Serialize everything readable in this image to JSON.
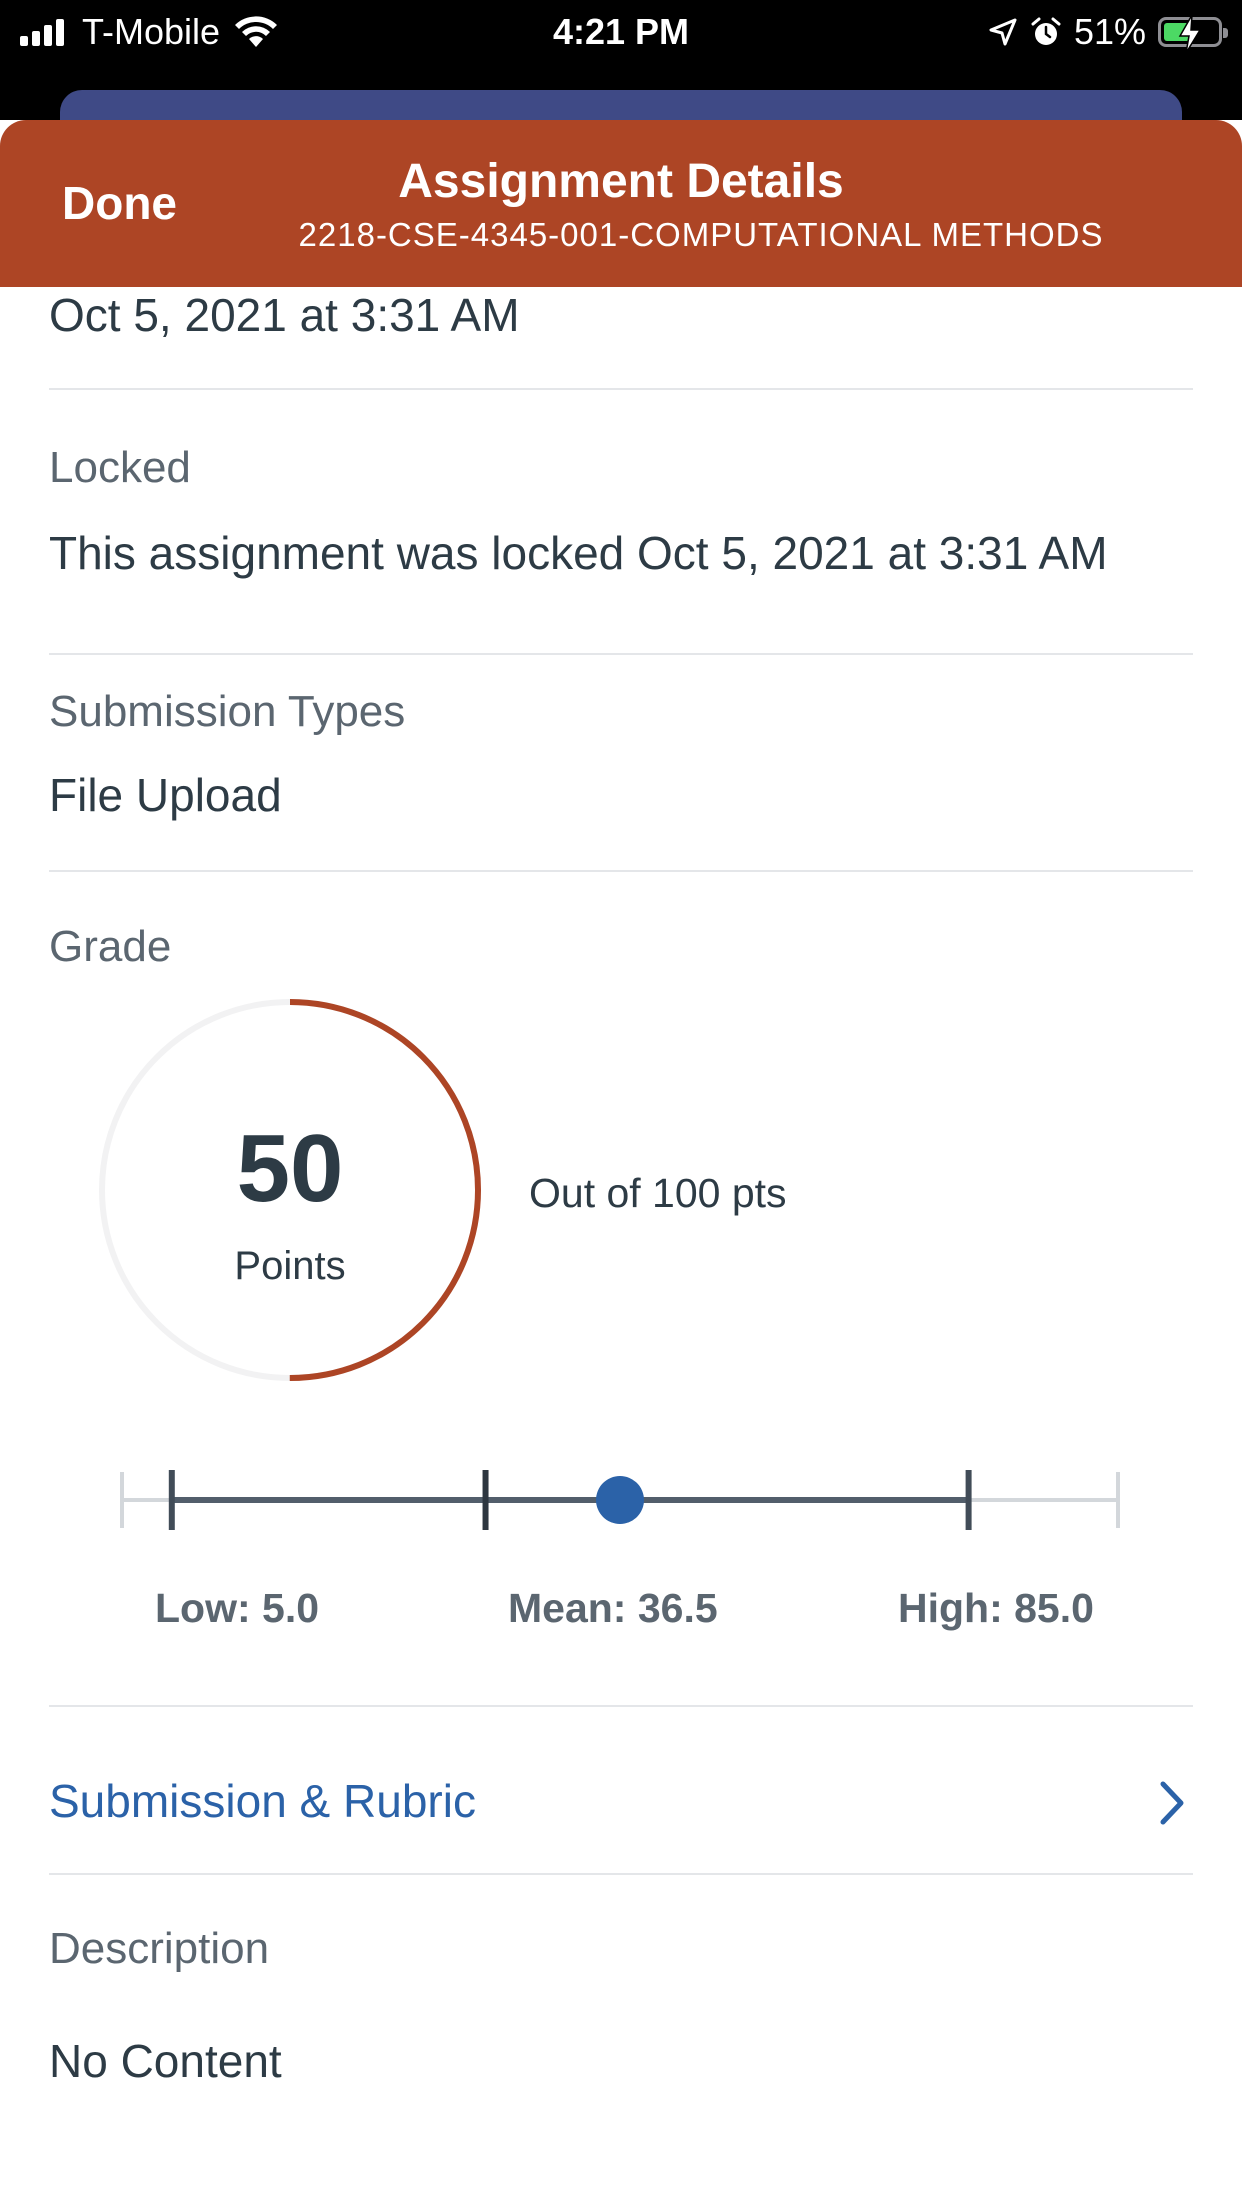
{
  "status_bar": {
    "carrier": "T-Mobile",
    "time": "4:21 PM",
    "battery": "51%",
    "icons": [
      "signal-icon",
      "wifi-icon",
      "location-icon",
      "alarm-icon",
      "battery-charging-icon"
    ]
  },
  "header": {
    "done_label": "Done",
    "title": "Assignment Details",
    "subtitle": "2218-CSE-4345-001-COMPUTATIONAL METHODS",
    "color": "#ad4525"
  },
  "due": {
    "value": "Oct 5, 2021 at 3:31 AM"
  },
  "locked": {
    "label": "Locked",
    "value": "This assignment was locked Oct 5, 2021 at 3:31 AM"
  },
  "submission_types": {
    "label": "Submission Types",
    "value": "File Upload"
  },
  "grade": {
    "label": "Grade",
    "score": "50",
    "score_unit": "Points",
    "out_of": "Out of 100 pts",
    "fraction": 0.5,
    "ring_color": "#ad4525"
  },
  "distribution": {
    "low_label": "Low: 5.0",
    "mean_label": "Mean: 36.5",
    "high_label": "High: 85.0",
    "low": 5.0,
    "mean": 36.5,
    "high": 85.0,
    "score": 50,
    "max": 100,
    "marker_color": "#2b62a8"
  },
  "submission_link": {
    "label": "Submission & Rubric"
  },
  "description": {
    "label": "Description",
    "value": "No Content"
  }
}
